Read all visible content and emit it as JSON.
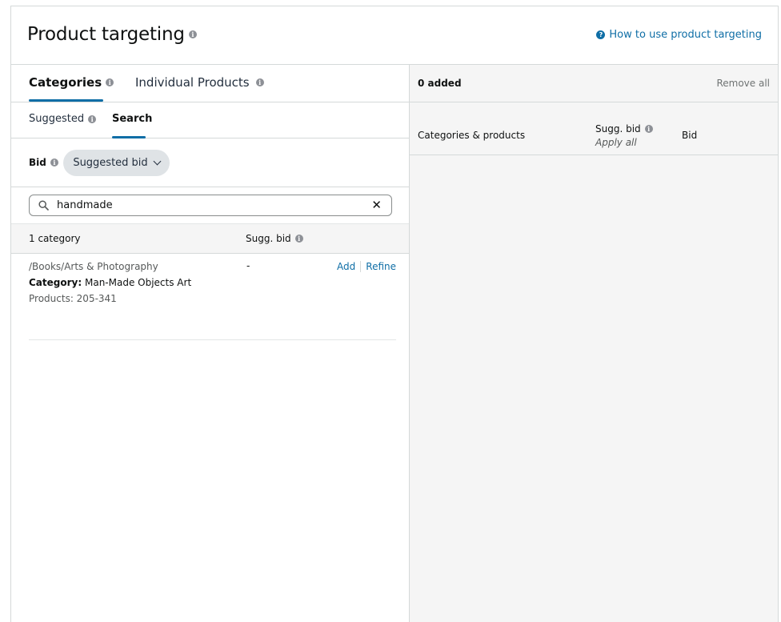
{
  "header": {
    "title": "Product targeting",
    "help_link": "How to use product targeting"
  },
  "tabs": [
    {
      "label": "Categories",
      "active": true
    },
    {
      "label": "Individual Products",
      "active": false
    }
  ],
  "subtabs": [
    {
      "label": "Suggested",
      "active": false
    },
    {
      "label": "Search",
      "active": true
    }
  ],
  "bid": {
    "label": "Bid",
    "dropdown_value": "Suggested bid"
  },
  "search": {
    "value": "handmade",
    "clear_glyph": "✕"
  },
  "results": {
    "count_label": "1 category",
    "sugg_bid_header": "Sugg. bid",
    "rows": [
      {
        "path": "/Books/Arts & Photography",
        "category_label": "Category:",
        "category_value": "Man-Made Objects Art",
        "products": "Products: 205-341",
        "sugg_bid": "-",
        "add_label": "Add",
        "refine_label": "Refine"
      }
    ]
  },
  "added": {
    "count_label": "0 added",
    "remove_all": "Remove all",
    "col_products": "Categories & products",
    "col_sugg_bid": "Sugg. bid",
    "apply_all": "Apply all",
    "col_bid": "Bid"
  },
  "colors": {
    "accent": "#0f6ea6",
    "border": "#d5d9d9",
    "panel_bg": "#f5f5f5",
    "pill_bg": "#dfe3e6"
  },
  "icons": {
    "info": "info-icon",
    "help": "help-circle-icon",
    "search": "search-icon",
    "clear": "clear-icon",
    "dropdown": "chevron-down-icon"
  }
}
